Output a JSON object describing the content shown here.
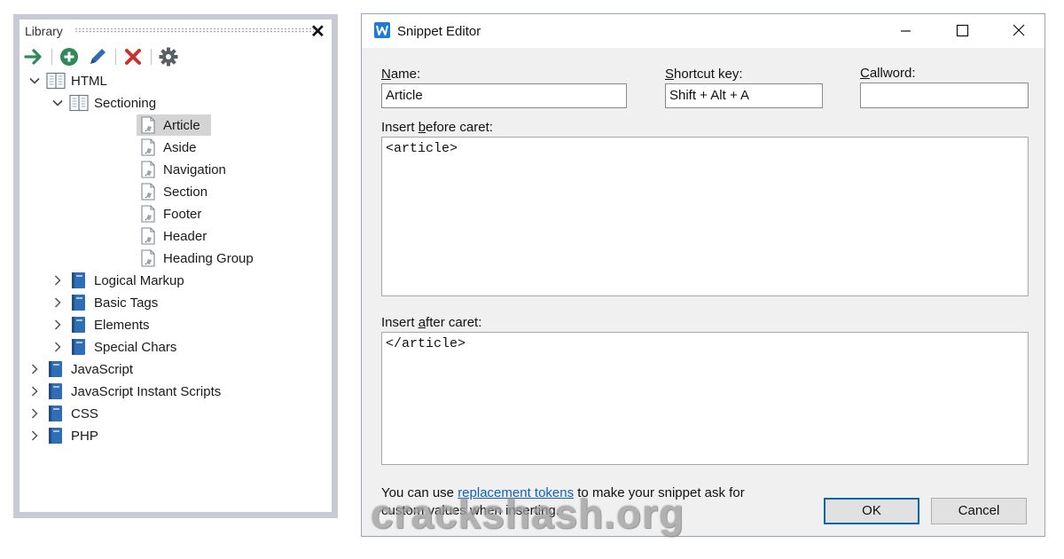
{
  "library": {
    "title": "Library",
    "toolbar": [
      {
        "name": "insert",
        "icon": "arrow-right-icon",
        "color": "#2e8b57"
      },
      {
        "name": "add",
        "icon": "plus-circle-icon",
        "color": "#2e8b57"
      },
      {
        "name": "edit",
        "icon": "pencil-icon",
        "color": "#2f6db5"
      },
      {
        "name": "delete",
        "icon": "red-x-icon",
        "color": "#d0302a"
      },
      {
        "name": "settings",
        "icon": "gear-icon",
        "color": "#5a5f66"
      }
    ],
    "tree": [
      {
        "label": "HTML",
        "expanded": true
      },
      {
        "label": "Sectioning",
        "expanded": true
      },
      {
        "label": "Article",
        "selected": true
      },
      {
        "label": "Aside"
      },
      {
        "label": "Navigation"
      },
      {
        "label": "Section"
      },
      {
        "label": "Footer"
      },
      {
        "label": "Header"
      },
      {
        "label": "Heading Group"
      },
      {
        "label": "Logical Markup",
        "expanded": false
      },
      {
        "label": "Basic Tags",
        "expanded": false
      },
      {
        "label": "Elements",
        "expanded": false
      },
      {
        "label": "Special Chars",
        "expanded": false
      },
      {
        "label": "JavaScript",
        "expanded": false
      },
      {
        "label": "JavaScript Instant Scripts",
        "expanded": false
      },
      {
        "label": "CSS",
        "expanded": false
      },
      {
        "label": "PHP",
        "expanded": false
      }
    ]
  },
  "dialog": {
    "title": "Snippet Editor",
    "name_label_first": "N",
    "name_label_rest": "ame:",
    "name_value": "Article",
    "shortcut_label_first": "S",
    "shortcut_label_rest": "hortcut key:",
    "shortcut_value": "Shift + Alt + A",
    "callword_label_first": "C",
    "callword_label_rest": "allword:",
    "callword_value": "",
    "before_label_pre": "Insert ",
    "before_label_u": "b",
    "before_label_post": "efore caret:",
    "before_value": "<article>",
    "after_label_pre": "Insert ",
    "after_label_u": "a",
    "after_label_post": "fter caret:",
    "after_value": "</article>",
    "footer_pre": "You can use ",
    "footer_link": "replacement tokens",
    "footer_post": " to make your snippet ask for",
    "footer_line2": "custom values when inserting.",
    "ok_label": "OK",
    "cancel_label": "Cancel"
  },
  "watermark": "crackshash.org",
  "colors": {
    "selection": "#d4d4d4",
    "book_blue": "#2f6db5",
    "link": "#1060c0",
    "default_button_border": "#0a64c8"
  }
}
